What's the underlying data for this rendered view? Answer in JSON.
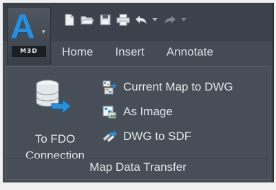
{
  "app": {
    "logo_letter": "A",
    "product_tag": "M3D",
    "caret": "▾"
  },
  "quick_access": {
    "icons": [
      "new-icon",
      "open-icon",
      "save-icon",
      "print-icon",
      "undo-icon",
      "undo-dropdown-icon",
      "redo-icon",
      "redo-dropdown-icon"
    ]
  },
  "tabs": [
    {
      "label": "Home"
    },
    {
      "label": "Insert"
    },
    {
      "label": "Annotate"
    }
  ],
  "panel": {
    "title": "Map Data Transfer",
    "big_button": {
      "line1": "To FDO",
      "line2": "Connection"
    },
    "small_buttons": [
      {
        "label": "Current Map to DWG",
        "icon": "map-to-dwg-icon"
      },
      {
        "label": "As Image",
        "icon": "image-icon"
      },
      {
        "label": "DWG to SDF",
        "icon": "dwg-to-sdf-icon"
      }
    ]
  },
  "colors": {
    "background": "#444b55",
    "accent": "#2a8fd8",
    "text": "#e4e7ea"
  }
}
